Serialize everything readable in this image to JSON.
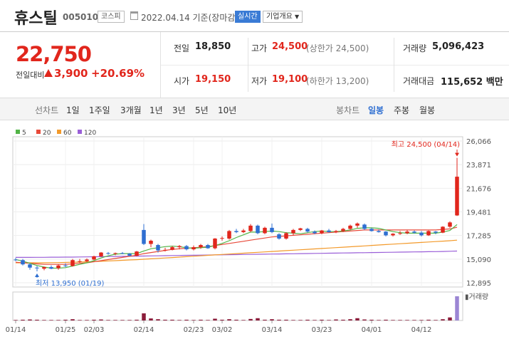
{
  "header": {
    "stock_name": "휴스틸",
    "stock_code": "005010",
    "market_badge": "코스피",
    "date_label": "2022.04.14 기준(장마감)",
    "realtime_button": "실시간",
    "company_overview_button": "기업개요"
  },
  "quote": {
    "price": "22,750",
    "change_label": "전일대비",
    "change_value": "3,900",
    "change_percent": "+20.69%",
    "prev_close_label": "전일",
    "prev_close": "18,850",
    "high_label": "고가",
    "high": "24,500",
    "high_note": "(상한가 24,500)",
    "volume_label": "거래량",
    "volume": "5,096,423",
    "open_label": "시가",
    "open": "19,150",
    "low_label": "저가",
    "low": "19,100",
    "low_note": "(하한가 13,200)",
    "amount_label": "거래대금",
    "amount": "115,652 백만"
  },
  "toolbar": {
    "line_chart_label": "선차트",
    "periods": [
      "1일",
      "1주일",
      "3개월",
      "1년",
      "3년",
      "5년",
      "10년"
    ],
    "candle_chart_label": "봉차트",
    "candle_periods": [
      "일봉",
      "주봉",
      "월봉"
    ],
    "candle_selected": "일봉"
  },
  "colors": {
    "up": "#e1261c",
    "down": "#2f6fd1",
    "ma5": "#52b447",
    "ma20": "#e84a3a",
    "ma60": "#f39a2b",
    "ma120": "#9a5fd8"
  },
  "chart_data": {
    "type": "candlestick",
    "legend": [
      {
        "name": "5",
        "color": "#52b447"
      },
      {
        "name": "20",
        "color": "#e84a3a"
      },
      {
        "name": "60",
        "color": "#f39a2b"
      },
      {
        "name": "120",
        "color": "#9a5fd8"
      }
    ],
    "y_ticks": [
      "26,066",
      "23,871",
      "21,676",
      "19,481",
      "17,285",
      "15,090",
      "12,895"
    ],
    "ylim": [
      12895,
      26066
    ],
    "x_ticks": [
      {
        "label": "01/14",
        "index": 0
      },
      {
        "label": "01/25",
        "index": 7
      },
      {
        "label": "02/03",
        "index": 11
      },
      {
        "label": "02/14",
        "index": 18
      },
      {
        "label": "02/23",
        "index": 25
      },
      {
        "label": "03/02",
        "index": 29
      },
      {
        "label": "03/14",
        "index": 36
      },
      {
        "label": "03/23",
        "index": 43
      },
      {
        "label": "04/01",
        "index": 50
      },
      {
        "label": "04/12",
        "index": 57
      }
    ],
    "high_annotation": "최고 24,500 (04/14)",
    "low_annotation": "최저 13,950 (01/19)",
    "volume_label": "거래량",
    "candles": [
      [
        15050,
        15200,
        14900,
        15000
      ],
      [
        15000,
        15100,
        14500,
        14600
      ],
      [
        14600,
        14700,
        14100,
        14300
      ],
      [
        14300,
        14450,
        13950,
        14250
      ],
      [
        14200,
        14400,
        14050,
        14350
      ],
      [
        14350,
        14500,
        14150,
        14200
      ],
      [
        14250,
        14600,
        14100,
        14500
      ],
      [
        14500,
        14700,
        14350,
        14450
      ],
      [
        14450,
        15100,
        14400,
        15000
      ],
      [
        14900,
        15100,
        14750,
        14900
      ],
      [
        14900,
        15150,
        14800,
        15050
      ],
      [
        15050,
        15400,
        15000,
        15350
      ],
      [
        15350,
        15750,
        15300,
        15700
      ],
      [
        15650,
        15750,
        15500,
        15600
      ],
      [
        15600,
        15700,
        15450,
        15650
      ],
      [
        15650,
        15750,
        15550,
        15600
      ],
      [
        15600,
        15650,
        15350,
        15400
      ],
      [
        15400,
        15850,
        15350,
        15800
      ],
      [
        17800,
        18350,
        16400,
        16500
      ],
      [
        16500,
        16900,
        16200,
        16800
      ],
      [
        16400,
        16500,
        15700,
        15900
      ],
      [
        15900,
        16150,
        15800,
        15950
      ],
      [
        15950,
        16300,
        15900,
        16200
      ],
      [
        16200,
        16400,
        16000,
        16300
      ],
      [
        16300,
        16400,
        15900,
        16000
      ],
      [
        16000,
        16350,
        15900,
        16200
      ],
      [
        16200,
        16500,
        16050,
        16400
      ],
      [
        16400,
        16500,
        16050,
        16100
      ],
      [
        16100,
        17050,
        16000,
        17000
      ],
      [
        17000,
        17200,
        16800,
        17050
      ],
      [
        17000,
        17800,
        16900,
        17700
      ],
      [
        17700,
        17900,
        17500,
        17600
      ],
      [
        17600,
        17900,
        17500,
        17750
      ],
      [
        17700,
        18350,
        17600,
        18200
      ],
      [
        18200,
        18300,
        17400,
        17500
      ],
      [
        17500,
        18100,
        17400,
        18000
      ],
      [
        18000,
        18400,
        17500,
        17600
      ],
      [
        17400,
        17500,
        16900,
        17000
      ],
      [
        17000,
        17600,
        16900,
        17500
      ],
      [
        17500,
        17900,
        17300,
        17800
      ],
      [
        17800,
        18000,
        17700,
        17950
      ],
      [
        17900,
        18000,
        17550,
        17650
      ],
      [
        17650,
        17750,
        17400,
        17500
      ],
      [
        17500,
        17800,
        17400,
        17750
      ],
      [
        17750,
        17900,
        17550,
        17600
      ],
      [
        17600,
        17800,
        17500,
        17700
      ],
      [
        17700,
        18000,
        17600,
        17900
      ],
      [
        17900,
        18300,
        17800,
        18200
      ],
      [
        18200,
        18500,
        18000,
        18400
      ],
      [
        18300,
        18400,
        17800,
        17900
      ],
      [
        17900,
        18000,
        17650,
        17700
      ],
      [
        17700,
        17850,
        17550,
        17600
      ],
      [
        17650,
        17700,
        17200,
        17300
      ],
      [
        17300,
        17500,
        17200,
        17450
      ],
      [
        17450,
        17700,
        17350,
        17500
      ],
      [
        17500,
        17800,
        17400,
        17650
      ],
      [
        17650,
        17750,
        17450,
        17550
      ],
      [
        17550,
        17700,
        17200,
        17300
      ],
      [
        17300,
        17750,
        17250,
        17700
      ],
      [
        17650,
        17700,
        17400,
        17550
      ],
      [
        17550,
        18150,
        17500,
        18100
      ],
      [
        18100,
        18600,
        18000,
        18500
      ],
      [
        19150,
        24500,
        19100,
        22750
      ]
    ],
    "ma5": [
      15050,
      14900,
      14700,
      14500,
      14350,
      14250,
      14250,
      14300,
      14450,
      14600,
      14750,
      14950,
      15200,
      15400,
      15550,
      15600,
      15600,
      15600,
      15850,
      16050,
      16150,
      16250,
      16300,
      16250,
      16150,
      16100,
      16150,
      16200,
      16350,
      16550,
      16800,
      17100,
      17350,
      17600,
      17600,
      17650,
      17700,
      17650,
      17550,
      17500,
      17450,
      17550,
      17650,
      17700,
      17650,
      17650,
      17700,
      17800,
      17950,
      18000,
      18000,
      17950,
      17800,
      17650,
      17550,
      17500,
      17500,
      17500,
      17500,
      17500,
      17600,
      17750,
      18300
    ],
    "ma20": [
      14800,
      14750,
      14700,
      14650,
      14600,
      14600,
      14600,
      14600,
      14650,
      14700,
      14750,
      14850,
      14950,
      15050,
      15150,
      15250,
      15350,
      15450,
      15600,
      15700,
      15800,
      15900,
      16000,
      16050,
      16100,
      16150,
      16200,
      16250,
      16350,
      16450,
      16550,
      16650,
      16750,
      16850,
      16950,
      17050,
      17150,
      17200,
      17250,
      17300,
      17350,
      17400,
      17450,
      17500,
      17550,
      17600,
      17650,
      17700,
      17750,
      17800,
      17800,
      17800,
      17800,
      17800,
      17800,
      17800,
      17800,
      17800,
      17800,
      17800,
      17850,
      17900,
      18050
    ],
    "ma60": [
      14750,
      14750,
      14750,
      14750,
      14750,
      14760,
      14770,
      14780,
      14800,
      14820,
      14840,
      14860,
      14890,
      14920,
      14950,
      14980,
      15010,
      15040,
      15080,
      15120,
      15160,
      15200,
      15240,
      15280,
      15320,
      15360,
      15400,
      15440,
      15480,
      15520,
      15560,
      15600,
      15640,
      15680,
      15720,
      15760,
      15800,
      15840,
      15880,
      15920,
      15960,
      16000,
      16040,
      16080,
      16120,
      16160,
      16200,
      16240,
      16280,
      16320,
      16360,
      16400,
      16440,
      16480,
      16520,
      16560,
      16600,
      16640,
      16680,
      16720,
      16760,
      16800,
      16850
    ],
    "ma120": [
      15250,
      15250,
      15250,
      15260,
      15260,
      15270,
      15270,
      15280,
      15280,
      15290,
      15300,
      15310,
      15320,
      15330,
      15340,
      15350,
      15360,
      15370,
      15380,
      15390,
      15400,
      15410,
      15420,
      15430,
      15440,
      15450,
      15460,
      15470,
      15480,
      15490,
      15500,
      15510,
      15520,
      15530,
      15540,
      15550,
      15560,
      15570,
      15580,
      15590,
      15600,
      15610,
      15620,
      15630,
      15640,
      15650,
      15660,
      15670,
      15680,
      15690,
      15700,
      15710,
      15720,
      15730,
      15740,
      15750,
      15760,
      15770,
      15780,
      15790,
      15800,
      15820,
      15840
    ],
    "volume": [
      2,
      3,
      4,
      3,
      2,
      2,
      2,
      3,
      5,
      2,
      2,
      3,
      4,
      2,
      2,
      2,
      2,
      3,
      28,
      8,
      5,
      3,
      3,
      2,
      3,
      2,
      3,
      2,
      7,
      3,
      5,
      3,
      2,
      6,
      9,
      3,
      5,
      3,
      3,
      2,
      2,
      3,
      2,
      3,
      2,
      4,
      3,
      5,
      9,
      4,
      3,
      2,
      3,
      2,
      2,
      2,
      2,
      2,
      3,
      2,
      5,
      12,
      95
    ]
  }
}
